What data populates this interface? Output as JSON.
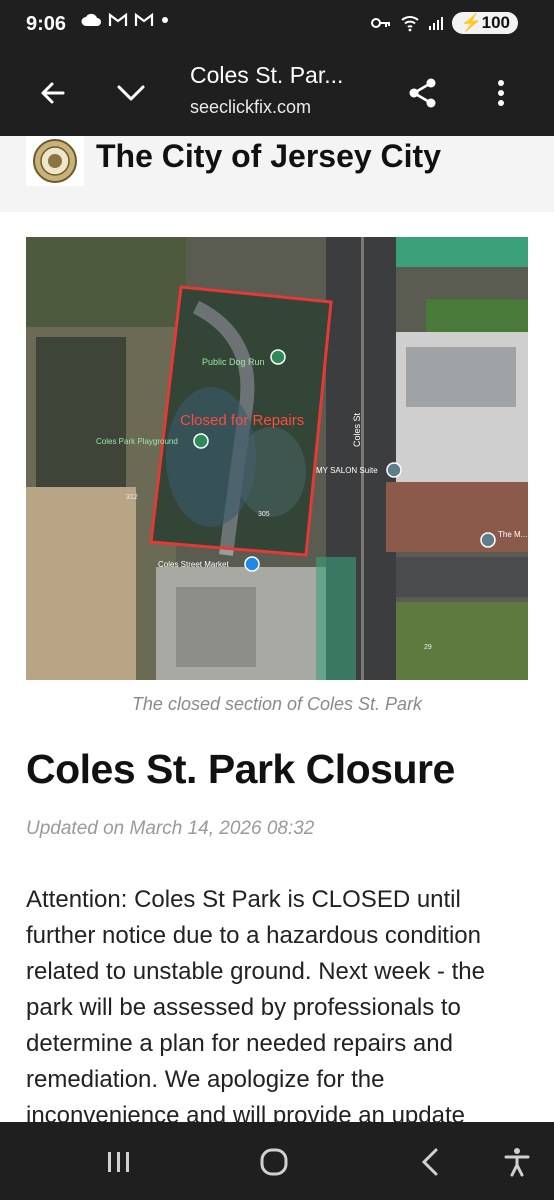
{
  "status_bar": {
    "time": "9:06",
    "battery": "100",
    "icons": [
      "cloud-icon",
      "gmail-icon",
      "gmail-icon",
      "dot-icon",
      "key-icon",
      "wifi-icon",
      "signal-icon",
      "battery-icon"
    ]
  },
  "toolbar": {
    "title": "Coles St. Par...",
    "url": "seeclickfix.com",
    "icons": [
      "back-arrow-icon",
      "chevron-down-icon",
      "share-icon",
      "more-vert-icon"
    ]
  },
  "header": {
    "org_name": "The City of Jersey City"
  },
  "map": {
    "closed_label": "Closed for Repairs",
    "labels": {
      "dog_run": "Public Dog Run",
      "playground": "Coles Park Playground",
      "street": "Coles St",
      "salon": "MY SALON Suite",
      "market": "Coles Street Market",
      "building": "The M... Buildin...",
      "num_312": "312",
      "num_305": "305",
      "num_29": "29"
    }
  },
  "article": {
    "caption": "The closed section of Coles St. Park",
    "title": "Coles St. Park Closure",
    "updated": "Updated on March 14, 2026 08:32",
    "body": "Attention: Coles St Park is CLOSED until further notice due to a hazardous condition related to unstable ground. Next week - the park will be assessed by professionals to determine a plan for needed repairs and remediation. We apologize for the inconvenience and will provide an update"
  },
  "nav_bar": {
    "icons": [
      "recents-icon",
      "home-icon",
      "back-icon",
      "accessibility-icon"
    ]
  },
  "colors": {
    "bar_bg": "#1f1f1f",
    "closed_outline": "#e53935",
    "text": "#111111",
    "muted": "#9a9a9a"
  }
}
